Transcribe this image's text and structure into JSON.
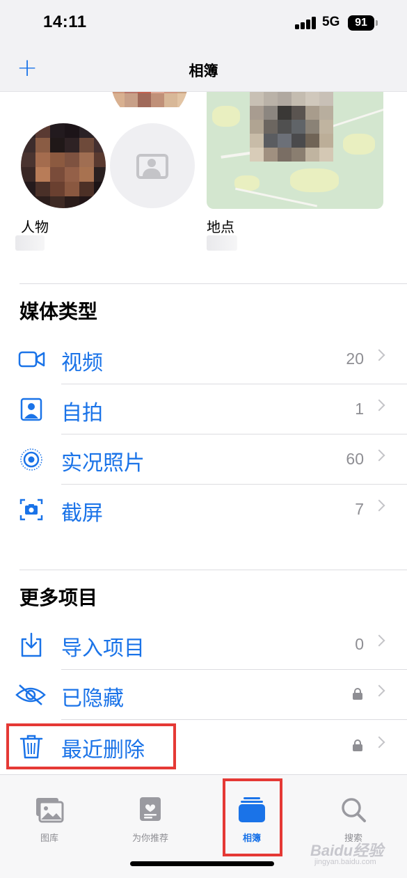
{
  "status_bar": {
    "time": "14:11",
    "network": "5G",
    "battery": "91"
  },
  "nav": {
    "add_icon": "plus-icon",
    "title": "相簿"
  },
  "people_places": {
    "people_label": "人物",
    "places_label": "地点"
  },
  "media_types": {
    "title": "媒体类型",
    "items": [
      {
        "label": "视频",
        "count": "20",
        "icon": "video-icon"
      },
      {
        "label": "自拍",
        "count": "1",
        "icon": "selfie-icon"
      },
      {
        "label": "实况照片",
        "count": "60",
        "icon": "live-photo-icon"
      },
      {
        "label": "截屏",
        "count": "7",
        "icon": "screenshot-icon"
      }
    ]
  },
  "more_items": {
    "title": "更多项目",
    "items": [
      {
        "label": "导入项目",
        "count": "0",
        "icon": "import-icon"
      },
      {
        "label": "已隐藏",
        "icon": "hidden-eye-icon",
        "locked": true
      },
      {
        "label": "最近删除",
        "icon": "trash-icon",
        "locked": true
      }
    ]
  },
  "tab_bar": {
    "tabs": [
      {
        "label": "图库",
        "icon": "library-icon",
        "active": false
      },
      {
        "label": "为你推荐",
        "icon": "for-you-icon",
        "active": false
      },
      {
        "label": "相簿",
        "icon": "albums-icon",
        "active": true
      },
      {
        "label": "搜索",
        "icon": "search-icon",
        "active": false
      }
    ]
  },
  "watermark": {
    "brand": "Baidu经验",
    "url": "jingyan.baidu.com"
  },
  "colors": {
    "accent": "#1a73e8",
    "highlight": "#e53935",
    "secondary_text": "#8e8e93"
  }
}
